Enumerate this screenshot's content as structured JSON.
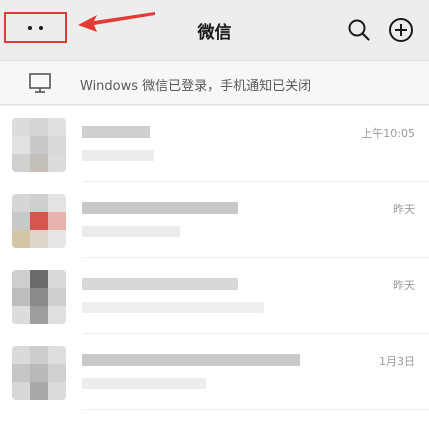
{
  "header": {
    "title": "微信",
    "more_icon": "more-dots-icon",
    "search_icon": "search-icon",
    "add_icon": "add-circle-icon"
  },
  "annotation": {
    "highlight_color": "#e53935"
  },
  "notice": {
    "icon": "monitor-icon",
    "text": "Windows 微信已登录，手机通知已关闭"
  },
  "chats": [
    {
      "time": "上午10:05"
    },
    {
      "time": "昨天"
    },
    {
      "time": "昨天"
    },
    {
      "time": "1月3日"
    }
  ]
}
